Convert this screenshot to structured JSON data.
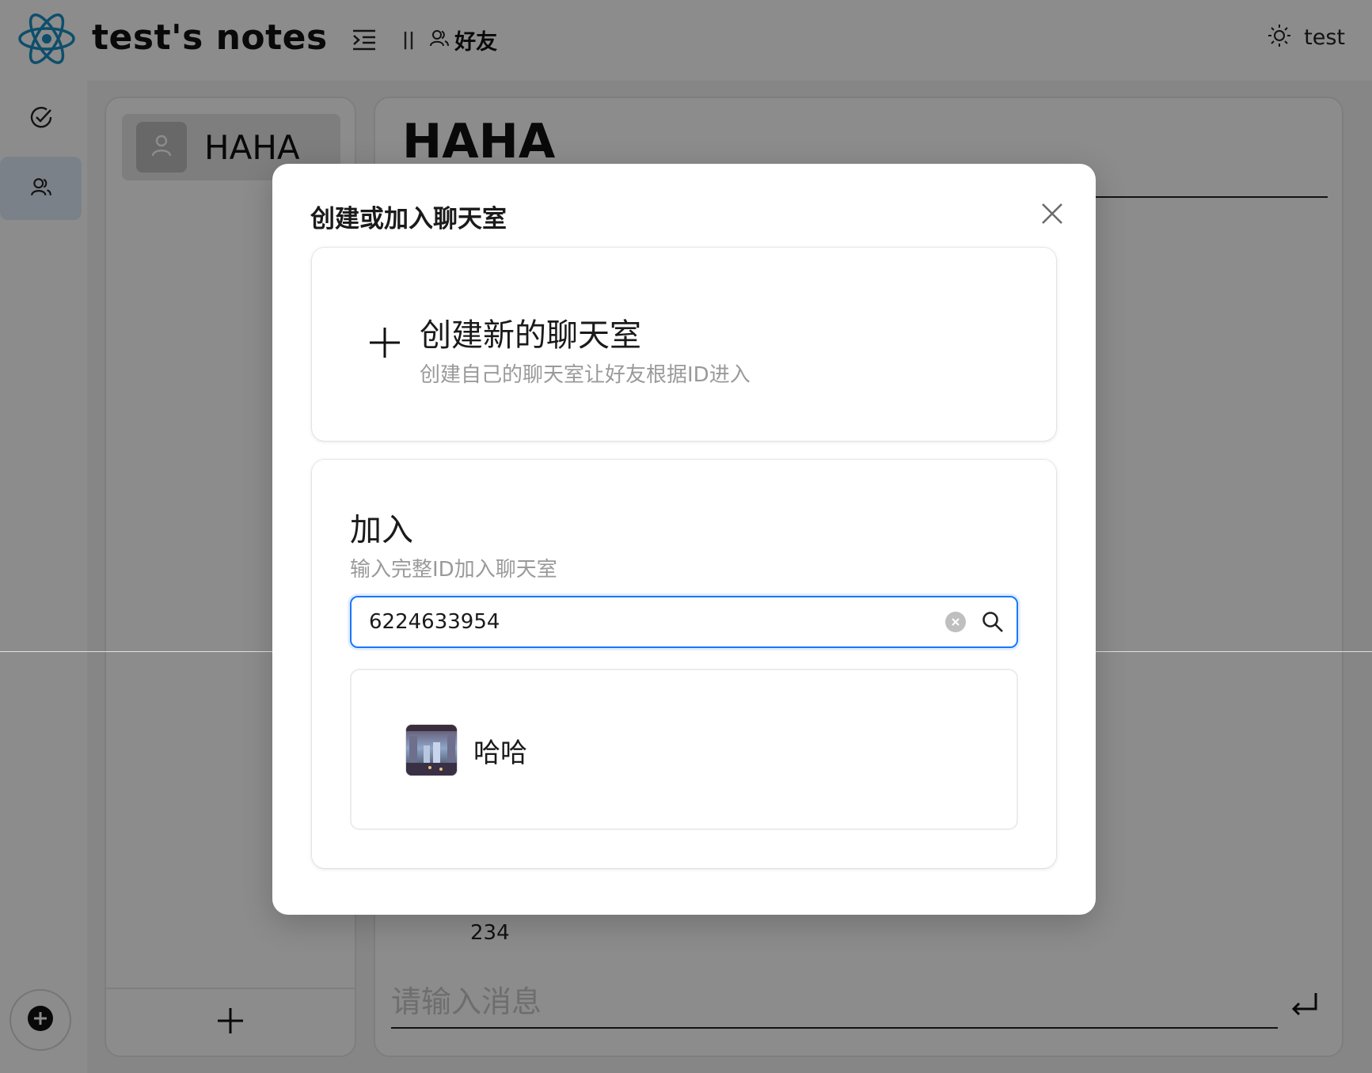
{
  "header": {
    "app_title": "test's notes",
    "divider": "||",
    "friends_label": "好友",
    "user_name": "test"
  },
  "room_list": {
    "items": [
      {
        "name": "HAHA"
      }
    ]
  },
  "chat": {
    "title": "HAHA",
    "visible_message": "234",
    "input_placeholder": "请输入消息"
  },
  "modal": {
    "title": "创建或加入聊天室",
    "create": {
      "title": "创建新的聊天室",
      "description": "创建自己的聊天室让好友根据ID进入"
    },
    "join": {
      "title": "加入",
      "description": "输入完整ID加入聊天室",
      "search_value": "6224633954",
      "results": [
        {
          "name": "哈哈"
        }
      ]
    }
  },
  "colors": {
    "accent": "#1677ff",
    "logo": "#1a8fc4",
    "rail_active": "#e0ecf8",
    "overlay": "rgba(0,0,0,0.45)"
  },
  "icons": {
    "logo": "react-atom-icon",
    "menu": "indent-menu-icon",
    "friends": "users-icon",
    "theme": "sun-icon",
    "rail_tasks": "check-circle-icon",
    "rail_friends": "users-icon",
    "rail_add": "plus-circle-icon",
    "close": "close-icon",
    "search": "search-icon",
    "clear": "clear-circle-icon",
    "send": "enter-key-icon"
  }
}
